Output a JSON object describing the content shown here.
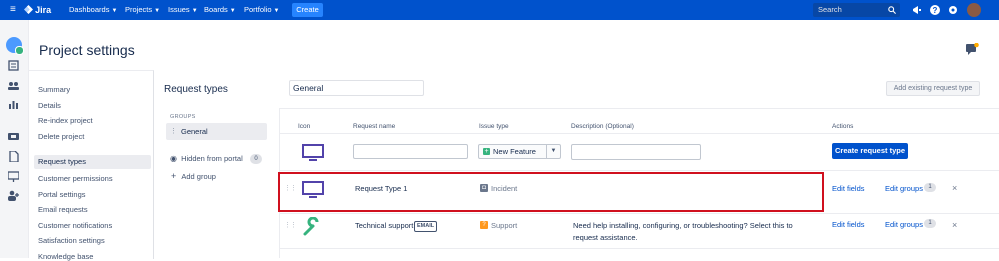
{
  "topbar": {
    "menu_icon": "hamburger-icon",
    "logo_text": "Jira",
    "nav": [
      "Dashboards",
      "Projects",
      "Issues",
      "Boards",
      "Portfolio"
    ],
    "create_label": "Create",
    "search_placeholder": "Search"
  },
  "page": {
    "title": "Project settings"
  },
  "sidenav": {
    "items": [
      "Summary",
      "Details",
      "Re-index project",
      "Delete project",
      "Request types",
      "Customer permissions",
      "Portal settings",
      "Email requests",
      "Customer notifications",
      "Satisfaction settings",
      "Knowledge base"
    ],
    "active": "Request types"
  },
  "groups": {
    "title": "Request types",
    "label": "GROUPS",
    "items": [
      "General"
    ],
    "hidden_label": "Hidden from portal",
    "hidden_count": "0",
    "add_label": "Add group"
  },
  "main": {
    "group_name": "General",
    "add_existing_label": "Add existing request type",
    "columns": [
      "Icon",
      "Request name",
      "Issue type",
      "Description (Optional)",
      "Actions"
    ],
    "new_row": {
      "issue_type": "New Feature",
      "create_label": "Create request type"
    },
    "rows": [
      {
        "name": "Request Type 1",
        "issue_type": "Incident",
        "description": "",
        "edit_fields": "Edit fields",
        "edit_groups": "Edit groups",
        "group_count": "1"
      },
      {
        "name": "Technical support",
        "lozenge": "EMAIL",
        "issue_type": "Support",
        "description_1": "Need help installing, configuring, or troubleshooting? Select this to",
        "description_2": "request assistance.",
        "edit_fields": "Edit fields",
        "edit_groups": "Edit groups",
        "group_count": "1"
      }
    ]
  },
  "colors": {
    "brand": "#0052cc",
    "highlight": "#d0101e"
  }
}
